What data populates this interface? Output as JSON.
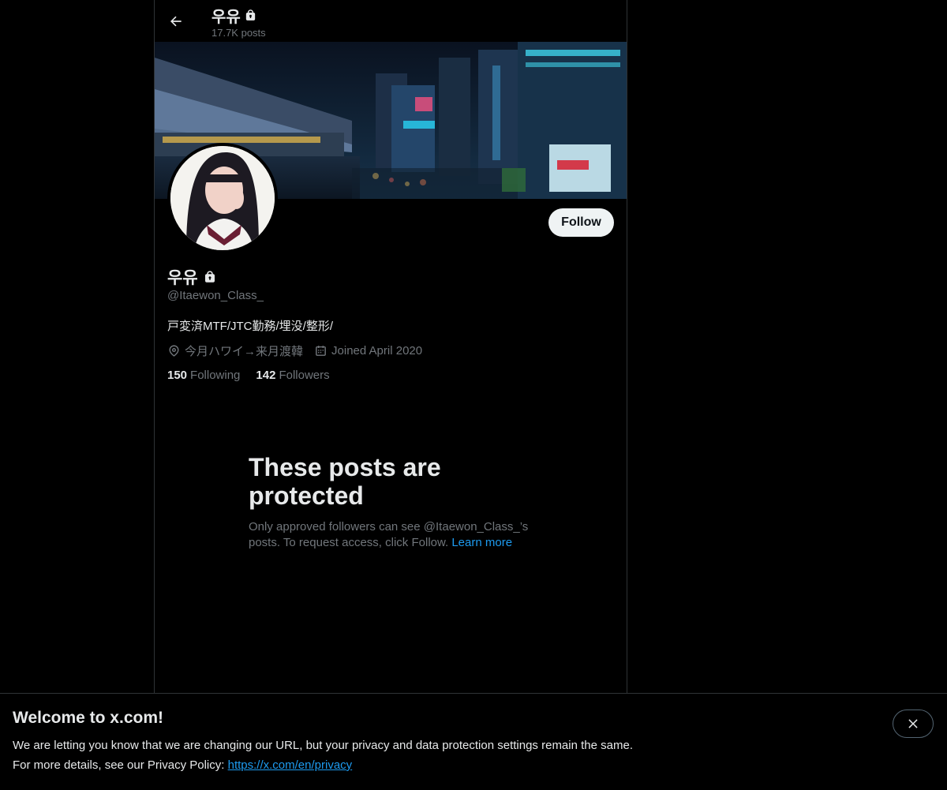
{
  "header": {
    "name": "우유",
    "posts_count": "17.7K posts"
  },
  "profile": {
    "display_name": "우유",
    "handle": "@Itaewon_Class_",
    "bio": "戸変済MTF/JTC勤務/埋没/整形/",
    "location": "今月ハワイ→来月渡韓",
    "joined": "Joined April 2020",
    "following_count": "150",
    "following_label": "Following",
    "followers_count": "142",
    "followers_label": "Followers",
    "follow_button": "Follow"
  },
  "protected": {
    "title": "These posts are protected",
    "body": "Only approved followers can see @Itaewon_Class_’s posts. To request access, click Follow.",
    "link": "Learn more"
  },
  "notice": {
    "title": "Welcome to x.com!",
    "line1": "We are letting you know that we are changing our URL, but your privacy and data protection settings remain the same.",
    "line2": "For more details, see our Privacy Policy:",
    "link": "https://x.com/en/privacy"
  },
  "colors": {
    "background": "#000000",
    "text_primary": "#e7e9ea",
    "text_secondary": "#71767b",
    "link": "#1d9bf0",
    "button_bg": "#eff3f4"
  },
  "icons": [
    "back-arrow-icon",
    "lock-icon",
    "location-pin-icon",
    "calendar-icon",
    "close-icon"
  ]
}
